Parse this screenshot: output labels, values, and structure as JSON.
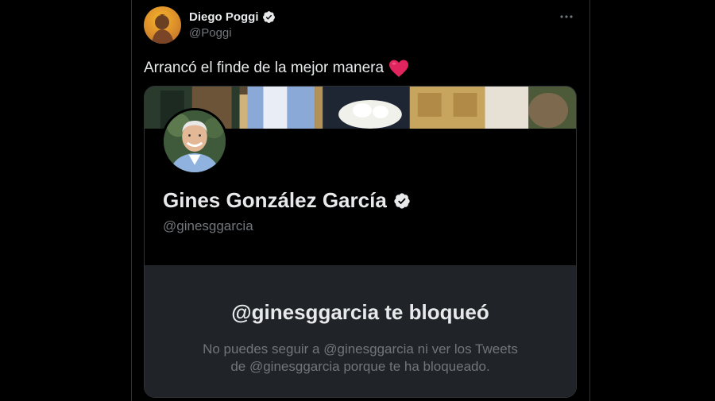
{
  "tweet": {
    "author": {
      "display_name": "Diego Poggi",
      "handle": "@Poggi",
      "verified": true
    },
    "text": "Arrancó el finde de la mejor manera",
    "emoji": "heart-emoji",
    "more_icon": "more-dots-icon"
  },
  "profile_card": {
    "display_name": "Gines González García",
    "handle": "@ginesggarcia",
    "verified": true,
    "blocked": {
      "title": "@ginesggarcia te bloqueó",
      "line1": "No puedes seguir a @ginesggarcia ni ver los Tweets",
      "line2": "de @ginesggarcia porque te ha bloqueado."
    }
  },
  "colors": {
    "background": "#000000",
    "primary_text": "#e7e9ea",
    "secondary_text": "#71767b",
    "blocked_panel": "#202327",
    "heart": "#e0245e"
  }
}
